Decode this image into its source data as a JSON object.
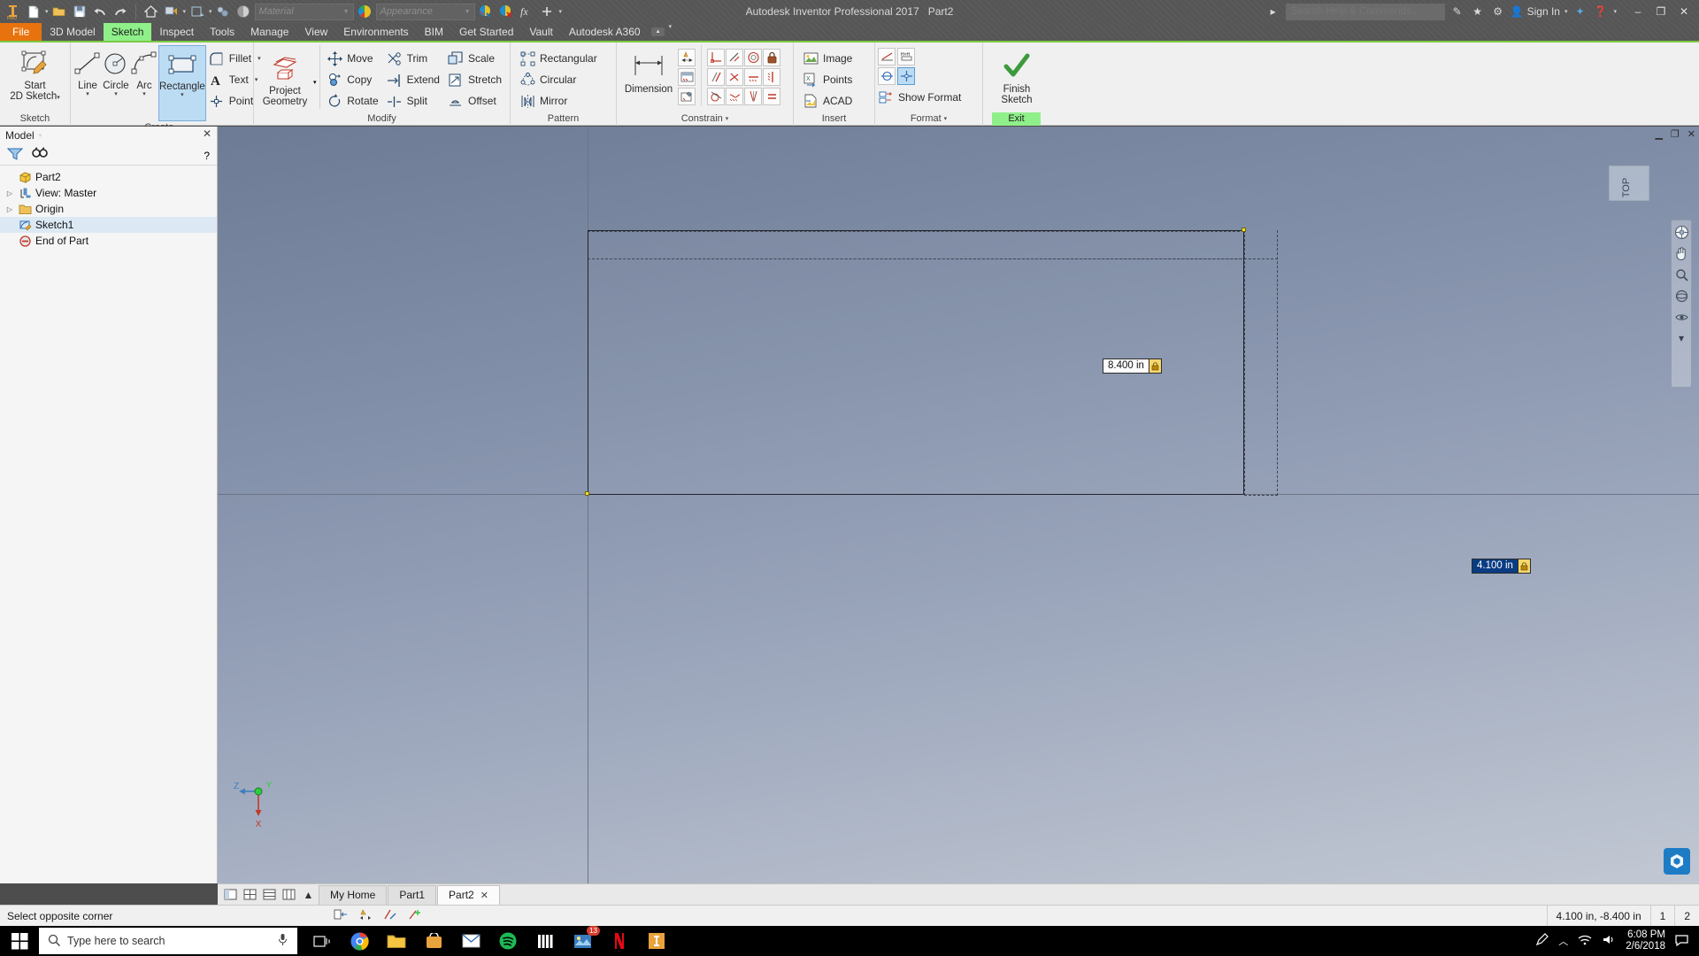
{
  "window": {
    "title": "Autodesk Inventor Professional 2017",
    "document": "Part2",
    "sign_in": "Sign In",
    "search_placeholder": "Search Help & Commands...",
    "minimize": "–",
    "restore": "❐",
    "close": "✕"
  },
  "quick_access": {
    "material_placeholder": "Material",
    "appearance_placeholder": "Appearance",
    "icons": [
      "new-icon",
      "open-icon",
      "save-icon",
      "undo-icon",
      "redo-icon",
      "home-icon",
      "return-icon",
      "update-icon",
      "select-icon",
      "appearance-icon",
      "material-icon",
      "fx-icon",
      "plus-icon",
      "customize-icon"
    ]
  },
  "tabs": [
    {
      "label": "File",
      "state": "file"
    },
    {
      "label": "3D Model",
      "state": "normal"
    },
    {
      "label": "Sketch",
      "state": "active"
    },
    {
      "label": "Inspect",
      "state": "normal"
    },
    {
      "label": "Tools",
      "state": "normal"
    },
    {
      "label": "Manage",
      "state": "normal"
    },
    {
      "label": "View",
      "state": "normal"
    },
    {
      "label": "Environments",
      "state": "normal"
    },
    {
      "label": "BIM",
      "state": "normal"
    },
    {
      "label": "Get Started",
      "state": "normal"
    },
    {
      "label": "Vault",
      "state": "normal"
    },
    {
      "label": "Autodesk A360",
      "state": "normal"
    }
  ],
  "ribbon": {
    "panels": [
      {
        "label": "Sketch",
        "name": "panel-sketch"
      },
      {
        "label": "Create",
        "name": "panel-create"
      },
      {
        "label": "Modify",
        "name": "panel-modify"
      },
      {
        "label": "Pattern",
        "name": "panel-pattern"
      },
      {
        "label": "Constrain",
        "name": "panel-constrain"
      },
      {
        "label": "Insert",
        "name": "panel-insert"
      },
      {
        "label": "Format",
        "name": "panel-format"
      },
      {
        "label": "Exit",
        "name": "panel-exit"
      }
    ],
    "sketch": {
      "start_2d_line1": "Start",
      "start_2d_line2": "2D Sketch"
    },
    "create": {
      "line": "Line",
      "circle": "Circle",
      "arc": "Arc",
      "rectangle": "Rectangle",
      "fillet": "Fillet",
      "text": "Text",
      "point": "Point",
      "project_line1": "Project",
      "project_line2": "Geometry"
    },
    "modify": {
      "move": "Move",
      "copy": "Copy",
      "rotate": "Rotate",
      "trim": "Trim",
      "extend": "Extend",
      "split": "Split",
      "scale": "Scale",
      "stretch": "Stretch",
      "offset": "Offset"
    },
    "pattern": {
      "rectangular": "Rectangular",
      "circular": "Circular",
      "mirror": "Mirror"
    },
    "constrain": {
      "dimension": "Dimension"
    },
    "insert": {
      "image": "Image",
      "points": "Points",
      "acad": "ACAD"
    },
    "format": {
      "show_format": "Show Format"
    },
    "exit": {
      "finish_line1": "Finish",
      "finish_line2": "Sketch",
      "exit_label": "Exit"
    }
  },
  "browser": {
    "header": "Model",
    "tools": [
      "filter-icon",
      "find-icon"
    ],
    "tree": [
      {
        "label": "Part2",
        "icon": "part-icon",
        "indent": 0,
        "expandable": false,
        "selected": false
      },
      {
        "label": "View: Master",
        "icon": "view-icon",
        "indent": 0,
        "expandable": true,
        "selected": false
      },
      {
        "label": "Origin",
        "icon": "folder-icon",
        "indent": 0,
        "expandable": true,
        "selected": false
      },
      {
        "label": "Sketch1",
        "icon": "sketch-icon",
        "indent": 0,
        "expandable": false,
        "selected": true
      },
      {
        "label": "End of Part",
        "icon": "endpart-icon",
        "indent": 0,
        "expandable": false,
        "selected": false
      }
    ]
  },
  "canvas": {
    "dimension_horizontal": "8.400 in",
    "dimension_vertical": "4.100 in",
    "viewcube_label": "TOP",
    "axis_labels": {
      "z": "Z",
      "y": "Y",
      "x": "X"
    }
  },
  "doc_tabs": [
    {
      "label": "My Home",
      "active": false,
      "closable": false
    },
    {
      "label": "Part1",
      "active": false,
      "closable": false
    },
    {
      "label": "Part2",
      "active": true,
      "closable": true
    }
  ],
  "status": {
    "message": "Select opposite corner",
    "coordinates": "4.100 in, -8.400 in",
    "value1": "1",
    "value2": "2"
  },
  "taskbar": {
    "search_placeholder": "Type here to search",
    "time": "6:08 PM",
    "date": "2/6/2018",
    "badge_count": "13",
    "apps": [
      "chrome-icon",
      "explorer-icon",
      "store-icon",
      "mail-icon",
      "spotify-icon",
      "library-icon",
      "photos-icon",
      "netflix-icon",
      "inventor-icon"
    ]
  },
  "colors": {
    "accent_green": "#8ff08a",
    "file_orange": "#e8730e",
    "selection_blue": "#bcdcf4",
    "dim_highlight": "#0a3c82",
    "lock_yellow": "#f5d76e"
  }
}
